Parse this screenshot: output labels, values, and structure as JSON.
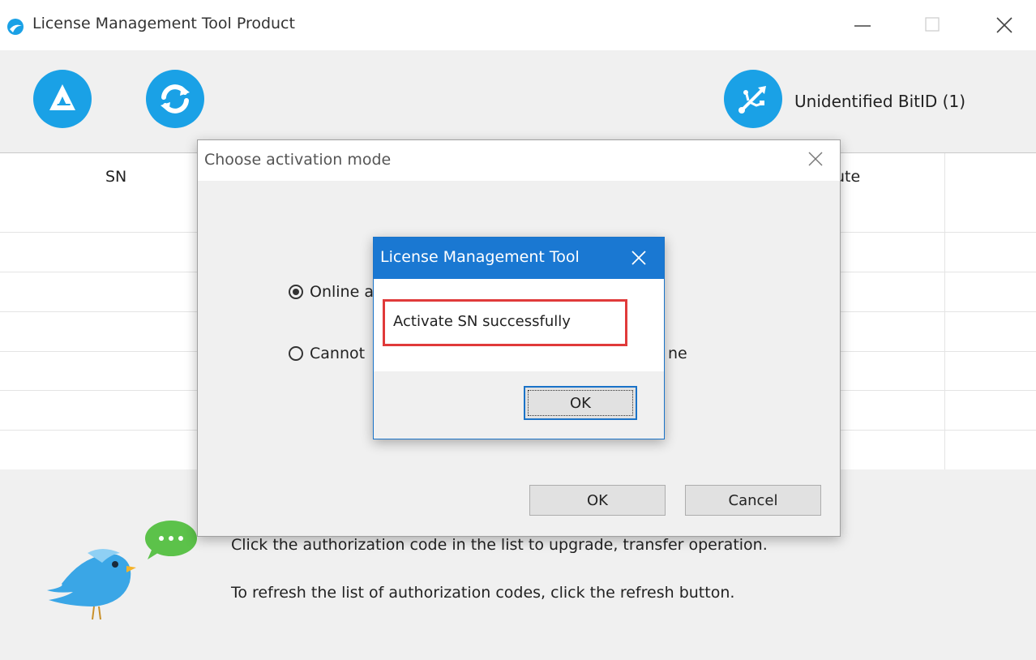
{
  "window": {
    "title": "License Management Tool Product"
  },
  "toolbar": {
    "activate_icon": "activate-a-icon",
    "refresh_icon": "refresh-icon",
    "usb_icon": "usb-key-icon",
    "bitid_label": "Unidentified BitID (1)"
  },
  "table": {
    "columns": [
      "SN",
      "ute"
    ]
  },
  "info": {
    "line1": "Click the authorization code in the list to upgrade, transfer operation.",
    "line2": "To refresh the list of authorization codes, click the refresh button."
  },
  "activation_dialog": {
    "title": "Choose activation mode",
    "option_online": "Online a",
    "option_offline_start": "Cannot",
    "option_offline_end": "ne",
    "ok_label": "OK",
    "cancel_label": "Cancel",
    "online_selected": true
  },
  "message_dialog": {
    "title": "License Management Tool",
    "message": "Activate SN successfully",
    "ok_label": "OK"
  },
  "colors": {
    "accent_blue": "#1aa1e6",
    "titlebar_blue": "#1a78d2",
    "highlight_red": "#e03a3a"
  }
}
